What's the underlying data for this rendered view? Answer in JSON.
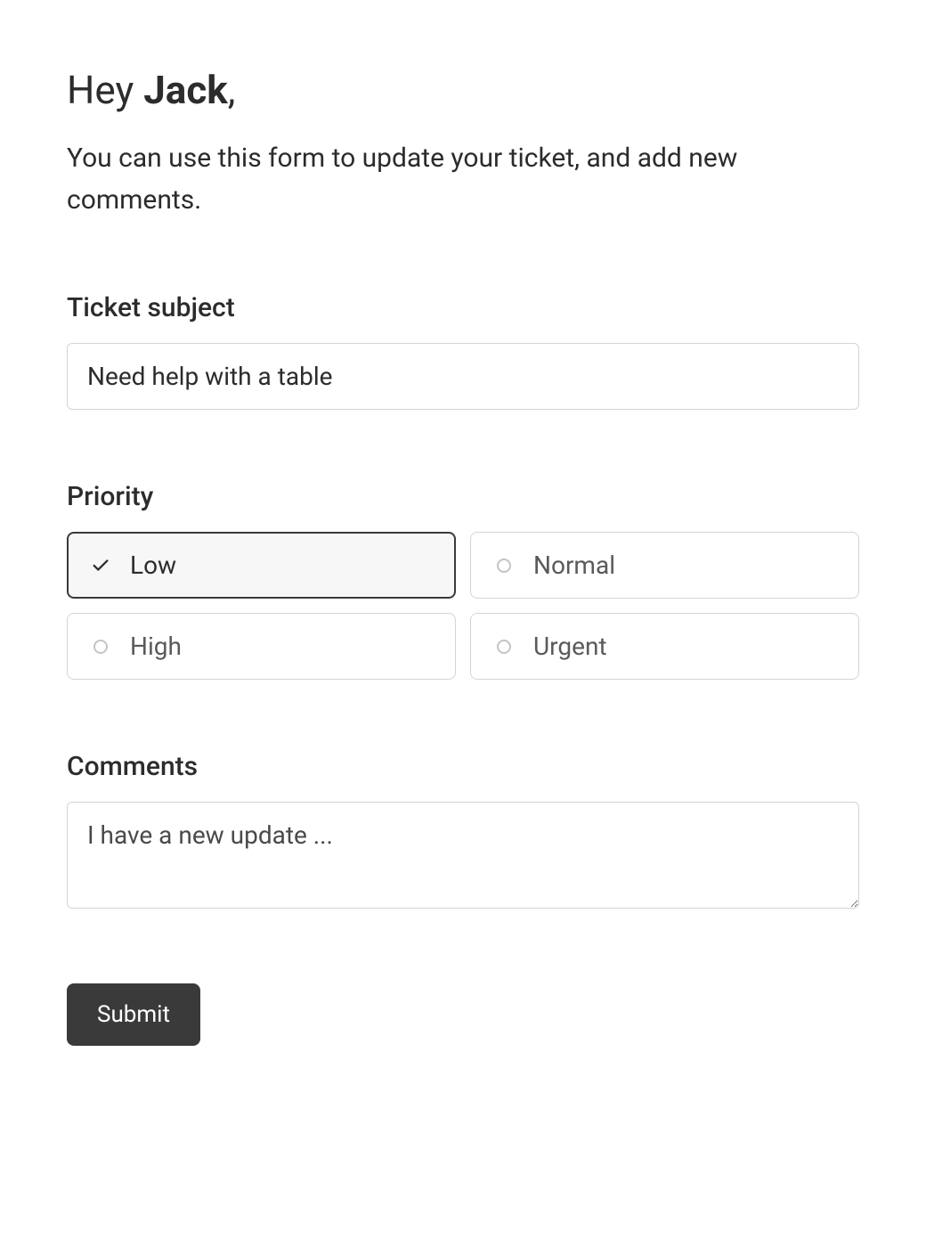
{
  "greeting": {
    "prefix": "Hey ",
    "name": "Jack",
    "suffix": ","
  },
  "description": "You can use this form to update your ticket, and add new comments.",
  "subject": {
    "label": "Ticket subject",
    "value": "Need help with a table"
  },
  "priority": {
    "label": "Priority",
    "selected": "Low",
    "options": [
      {
        "label": "Low",
        "selected": true
      },
      {
        "label": "Normal",
        "selected": false
      },
      {
        "label": "High",
        "selected": false
      },
      {
        "label": "Urgent",
        "selected": false
      }
    ]
  },
  "comments": {
    "label": "Comments",
    "placeholder": "I have a new update ...",
    "value": ""
  },
  "submit": {
    "label": "Submit"
  }
}
